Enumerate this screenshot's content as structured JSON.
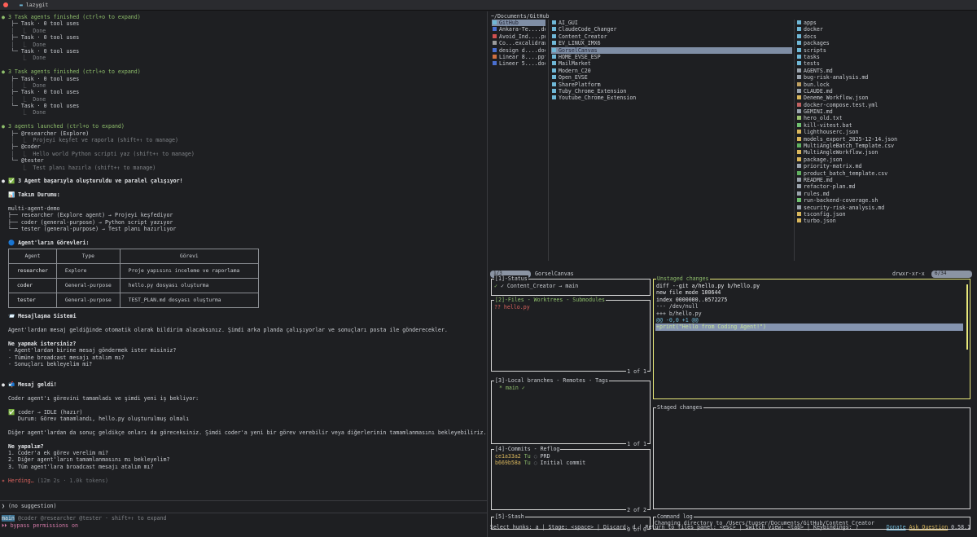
{
  "window": {
    "title": "lazygit"
  },
  "claude": {
    "lines": [
      {
        "t": "● 3 Task agents finished (ctrl+o to expand)",
        "c": "g"
      },
      {
        "t": "   ├─ Task · 0 tool uses",
        "c": ""
      },
      {
        "t": "   │  ⎿  Done",
        "c": "gr"
      },
      {
        "t": "   ├─ Task · 0 tool uses",
        "c": ""
      },
      {
        "t": "   │  ⎿  Done",
        "c": "gr"
      },
      {
        "t": "   └─ Task · 0 tool uses",
        "c": ""
      },
      {
        "t": "      ⎿  Done",
        "c": "gr"
      },
      {
        "t": "",
        "c": ""
      },
      {
        "t": "● 3 Task agents finished (ctrl+o to expand)",
        "c": "g"
      },
      {
        "t": "   ├─ Task · 0 tool uses",
        "c": ""
      },
      {
        "t": "   │  ⎿  Done",
        "c": "gr"
      },
      {
        "t": "   ├─ Task · 0 tool uses",
        "c": ""
      },
      {
        "t": "   │  ⎿  Done",
        "c": "gr"
      },
      {
        "t": "   └─ Task · 0 tool uses",
        "c": ""
      },
      {
        "t": "      ⎿  Done",
        "c": "gr"
      },
      {
        "t": "",
        "c": ""
      },
      {
        "t": "● 3 agents launched (ctrl+o to expand)",
        "c": "g"
      },
      {
        "t": "   ├─ @researcher (Explore)",
        "c": ""
      },
      {
        "t": "   │  ⎿  Projeyi keşfet ve raporla (shift+↑ to manage)",
        "c": "gr"
      },
      {
        "t": "   ├─ @coder",
        "c": ""
      },
      {
        "t": "   │  ⎿  Hello world Python scripti yaz (shift+↑ to manage)",
        "c": "gr"
      },
      {
        "t": "   └─ @tester",
        "c": ""
      },
      {
        "t": "      ⎿  Test planı hazırla (shift+↑ to manage)",
        "c": "gr"
      },
      {
        "t": "",
        "c": ""
      },
      {
        "t": "● ✅ 3 Agent başarıyla oluşturuldu ve paralel çalışıyor!",
        "c": "w b"
      },
      {
        "t": "",
        "c": ""
      },
      {
        "t": "  📊 Takım Durumu:",
        "c": "w b"
      },
      {
        "t": "",
        "c": ""
      },
      {
        "t": "  multi-agent-demo",
        "c": ""
      },
      {
        "t": "  ├── researcher (Explore agent) → Projeyi keşfediyor",
        "c": ""
      },
      {
        "t": "  ├── coder (general-purpose) → Python script yazıyor",
        "c": ""
      },
      {
        "t": "  └── tester (general-purpose) → Test planı hazırlıyor",
        "c": ""
      },
      {
        "t": "",
        "c": ""
      },
      {
        "t": "  🔵 Agent'ların Görevleri:",
        "c": "w b"
      }
    ],
    "table": {
      "headers": [
        "Agent",
        "Type",
        "Görevi"
      ],
      "rows": [
        [
          "researcher",
          "Explore",
          "Proje yapısını inceleme ve raporlama"
        ],
        [
          "coder",
          "General-purpose",
          "hello.py dosyası oluşturma"
        ],
        [
          "tester",
          "General-purpose",
          "TEST_PLAN.md dosyası oluşturma"
        ]
      ]
    },
    "lines2": [
      {
        "t": "  📨 Mesajlaşma Sistemi",
        "c": "w b"
      },
      {
        "t": "",
        "c": ""
      },
      {
        "t": "  Agent'lardan mesaj geldiğinde otomatik olarak bildirim alacaksınız. Şimdi arka planda çalışıyorlar ve sonuçları posta ile gönderecekler.",
        "c": ""
      },
      {
        "t": "",
        "c": ""
      },
      {
        "t": "  Ne yapmak istersiniz?",
        "c": "w b"
      },
      {
        "t": "  - Agent'lardan birine mesaj göndermek ister misiniz?",
        "c": ""
      },
      {
        "t": "  - Tümüne broadcast mesajı atalım mı?",
        "c": ""
      },
      {
        "t": "  - Sonuçları bekleyelim mi?",
        "c": ""
      },
      {
        "t": "",
        "c": ""
      },
      {
        "t": "",
        "c": ""
      },
      {
        "t": "● 📬 Mesaj geldi!",
        "c": "w b"
      },
      {
        "t": "",
        "c": ""
      },
      {
        "t": "  Coder agent'ı görevini tamamladı ve şimdi yeni iş bekliyor:",
        "c": ""
      },
      {
        "t": "",
        "c": ""
      },
      {
        "t": "  ✅ coder → IDLE (hazır)",
        "c": ""
      },
      {
        "t": "     Durum: Görev tamamlandı, hello.py oluşturulmuş olmalı",
        "c": ""
      },
      {
        "t": "",
        "c": ""
      },
      {
        "t": "  Diğer agent'lardan da sonuç geldikçe onları da göreceksiniz. Şimdi coder'a yeni bir görev verebilir veya diğerlerinin tamamlanmasını bekleyebiliriz.",
        "c": ""
      },
      {
        "t": "",
        "c": ""
      },
      {
        "t": "  Ne yapalım?",
        "c": "w b"
      },
      {
        "t": "  1. Coder'a ek görev verelim mi?",
        "c": ""
      },
      {
        "t": "  2. Diğer agent'ların tamamlanmasını mı bekleyelim?",
        "c": ""
      },
      {
        "t": "  3. Tüm agent'lara broadcast mesajı atalım mı?",
        "c": ""
      },
      {
        "t": "",
        "c": ""
      }
    ],
    "status": {
      "word": "✶ Herding…",
      "rest": " (12m 2s · 1.0k tokens)"
    },
    "prompt": "❯ (no suggestion)",
    "footer": {
      "main": "main",
      "agents": " @coder @researcher @tester · shift+↑ to expand",
      "perm": "⏵⏵ bypass permissions on"
    }
  },
  "finder": {
    "path": "~/Documents/GitHub",
    "col1": [
      {
        "n": "GitHub",
        "k": "dir",
        "s": true
      },
      {
        "n": "Ankara-Te....doc",
        "k": "doc"
      },
      {
        "n": "Avoid_Ind....pdf",
        "k": "pdf"
      },
      {
        "n": "Co...excalidraw",
        "k": "file"
      },
      {
        "n": "design d....docx",
        "k": "doc"
      },
      {
        "n": "Linear 8....pptx",
        "k": "ppt"
      },
      {
        "n": "Lineer 5....docx",
        "k": "doc"
      }
    ],
    "col2": [
      {
        "n": "AI_GUI",
        "k": "dir"
      },
      {
        "n": "ClaudeCode_Changer",
        "k": "dir"
      },
      {
        "n": "Content_Creator",
        "k": "dir"
      },
      {
        "n": "EV_LINUX_IMX6",
        "k": "dir"
      },
      {
        "n": "GorselCanvas",
        "k": "dir",
        "s": true
      },
      {
        "n": "HOME_EVSE_ESP",
        "k": "dir"
      },
      {
        "n": "MailMarket",
        "k": "dir"
      },
      {
        "n": "Modern_C20",
        "k": "dir"
      },
      {
        "n": "Open_EVSE",
        "k": "dir"
      },
      {
        "n": "SharePlatform",
        "k": "dir"
      },
      {
        "n": "Tuby_Chrome_Extension",
        "k": "dir"
      },
      {
        "n": "Youtube_Chrome_Extension",
        "k": "dir"
      }
    ],
    "col3": [
      {
        "n": "apps",
        "k": "dir"
      },
      {
        "n": "docker",
        "k": "dir"
      },
      {
        "n": "docs",
        "k": "dir"
      },
      {
        "n": "packages",
        "k": "dir"
      },
      {
        "n": "scripts",
        "k": "dir"
      },
      {
        "n": "tasks",
        "k": "dir"
      },
      {
        "n": "tests",
        "k": "dir"
      },
      {
        "n": "AGENTS.md",
        "k": "md"
      },
      {
        "n": "bug-risk-analysis.md",
        "k": "md"
      },
      {
        "n": "bun.lock",
        "k": "lock"
      },
      {
        "n": "CLAUDE.md",
        "k": "md"
      },
      {
        "n": "Deneme_Workflow.json",
        "k": "json"
      },
      {
        "n": "docker-compose.test.yml",
        "k": "yml"
      },
      {
        "n": "GEMINI.md",
        "k": "md"
      },
      {
        "n": "hero_old.txt",
        "k": "txt"
      },
      {
        "n": "kill-vitest.bat",
        "k": "bat"
      },
      {
        "n": "lighthouserc.json",
        "k": "json"
      },
      {
        "n": "models_export_2025-12-14.json",
        "k": "json"
      },
      {
        "n": "MultiAngleBatch_Template.csv",
        "k": "csv"
      },
      {
        "n": "MultiAngleWorkflow.json",
        "k": "json"
      },
      {
        "n": "package.json",
        "k": "js"
      },
      {
        "n": "priority-matrix.md",
        "k": "md"
      },
      {
        "n": "product_batch_template.csv",
        "k": "csv"
      },
      {
        "n": "README.md",
        "k": "md"
      },
      {
        "n": "refactor-plan.md",
        "k": "md"
      },
      {
        "n": "rules.md",
        "k": "md"
      },
      {
        "n": "run-backend-coverage.sh",
        "k": "sh"
      },
      {
        "n": "security-risk-analysis.md",
        "k": "md"
      },
      {
        "n": "tsconfig.json",
        "k": "json"
      },
      {
        "n": "turbo.json",
        "k": "json"
      }
    ],
    "bar_left": "1/3",
    "bar_name": "GorselCanvas",
    "bar_perm": "drwxr-xr-x",
    "bar_right": "6/34"
  },
  "git": {
    "status": {
      "title": "[1]-Status",
      "line": "✓ Content_Creator → main"
    },
    "files": {
      "title": "[2]-Files - Worktrees - Submodules",
      "item": "?? hello.py",
      "count": "1 of 1"
    },
    "branches": {
      "title": "[3]-Local branches - Remotes - Tags",
      "item": "* main ✓",
      "count": "1 of 1"
    },
    "commits": {
      "title": "[4]-Commits - Reflog",
      "items": [
        {
          "h": "ce1a33a2",
          "a": "Tu",
          "m": "PRD"
        },
        {
          "h": "b669b58a",
          "a": "Tu",
          "m": "Initial commit"
        }
      ],
      "count": "2 of 2"
    },
    "stash": {
      "title": "[5]-Stash",
      "count": "0 of 0"
    },
    "unstaged": {
      "title": "Unstaged changes",
      "lines": [
        "diff --git a/hello.py b/hello.py",
        "new file mode 100644",
        "index 0000000..0572275",
        "--- /dev/null",
        "+++ b/hello.py",
        "@@ -0,0 +1 @@",
        "+print(\"Hello from Coding Agent!\")"
      ]
    },
    "staged": {
      "title": "Staged changes"
    },
    "log": {
      "title": "Command log",
      "line": "  Changing directory to /Users/tugser/Documents/GitHub/Content_Creator"
    },
    "keys": "Select hunks: a | Stage: <space> | Discard: d | Return to files panel: <esc> | Switch view: <tab> | Keybindings: ?",
    "links": {
      "donate": "Donate",
      "ask": "Ask Question",
      "version": "0.58.1"
    }
  }
}
